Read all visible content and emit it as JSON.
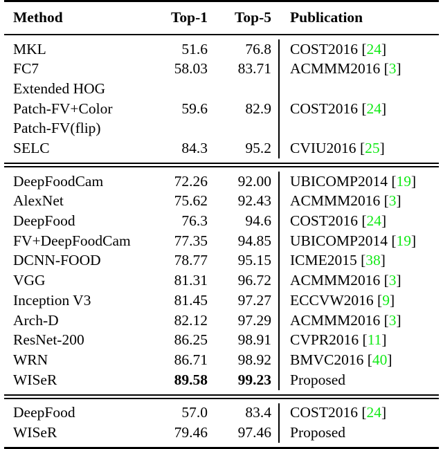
{
  "table": {
    "columns": [
      "Method",
      "Top-1",
      "Top-5",
      "Publication"
    ],
    "sections": [
      {
        "id": "handcrafted",
        "rows": [
          {
            "method": "MKL",
            "top1": "51.6",
            "top5": "76.8",
            "pub_venue": "COST2016",
            "pub_ref": "24"
          },
          {
            "method": "FC7",
            "top1": "58.03",
            "top5": "83.71",
            "pub_venue": "ACMMM2016",
            "pub_ref": "3"
          },
          {
            "method": "Extended HOG",
            "top1": "",
            "top5": "",
            "pub_venue": "",
            "pub_ref": ""
          },
          {
            "method": "Patch-FV+Color",
            "top1": "59.6",
            "top5": "82.9",
            "pub_venue": "COST2016",
            "pub_ref": "24"
          },
          {
            "method": "Patch-FV(flip)",
            "top1": "",
            "top5": "",
            "pub_venue": "",
            "pub_ref": ""
          },
          {
            "method": "SELC",
            "top1": "84.3",
            "top5": "95.2",
            "pub_venue": "CVIU2016",
            "pub_ref": "25"
          }
        ]
      },
      {
        "id": "deep",
        "rows": [
          {
            "method": "DeepFoodCam",
            "top1": "72.26",
            "top5": "92.00",
            "pub_venue": "UBICOMP2014",
            "pub_ref": "19"
          },
          {
            "method": "AlexNet",
            "top1": "75.62",
            "top5": "92.43",
            "pub_venue": "ACMMM2016",
            "pub_ref": "3"
          },
          {
            "method": "DeepFood",
            "top1": "76.3",
            "top5": "94.6",
            "pub_venue": "COST2016",
            "pub_ref": "24"
          },
          {
            "method": "FV+DeepFoodCam",
            "top1": "77.35",
            "top5": "94.85",
            "pub_venue": "UBICOMP2014",
            "pub_ref": "19"
          },
          {
            "method": "DCNN-FOOD",
            "top1": "78.77",
            "top5": "95.15",
            "pub_venue": "ICME2015",
            "pub_ref": "38"
          },
          {
            "method": "VGG",
            "top1": "81.31",
            "top5": "96.72",
            "pub_venue": "ACMMM2016",
            "pub_ref": "3"
          },
          {
            "method": "Inception V3",
            "top1": "81.45",
            "top5": "97.27",
            "pub_venue": "ECCVW2016",
            "pub_ref": "9"
          },
          {
            "method": "Arch-D",
            "top1": "82.12",
            "top5": "97.29",
            "pub_venue": "ACMMM2016",
            "pub_ref": "3"
          },
          {
            "method": "ResNet-200",
            "top1": "86.25",
            "top5": "98.91",
            "pub_venue": "CVPR2016",
            "pub_ref": "11"
          },
          {
            "method": "WRN",
            "top1": "86.71",
            "top5": "98.92",
            "pub_venue": "BMVC2016",
            "pub_ref": "40"
          },
          {
            "method": "WISeR",
            "top1": "89.58",
            "top5": "99.23",
            "pub_venue": "Proposed",
            "pub_ref": "",
            "bold_values": true
          }
        ]
      },
      {
        "id": "other-dataset",
        "rows": [
          {
            "method": "DeepFood",
            "top1": "57.0",
            "top5": "83.4",
            "pub_venue": "COST2016",
            "pub_ref": "24"
          },
          {
            "method": "WISeR",
            "top1": "79.46",
            "top5": "97.46",
            "pub_venue": "Proposed",
            "pub_ref": ""
          }
        ]
      }
    ]
  },
  "style": {
    "citation_color": "#11e916",
    "rule_color": "#000000",
    "text_color": "#000000",
    "background": "#ffffff"
  },
  "citation_brackets": {
    "open": "[",
    "close": "]"
  }
}
